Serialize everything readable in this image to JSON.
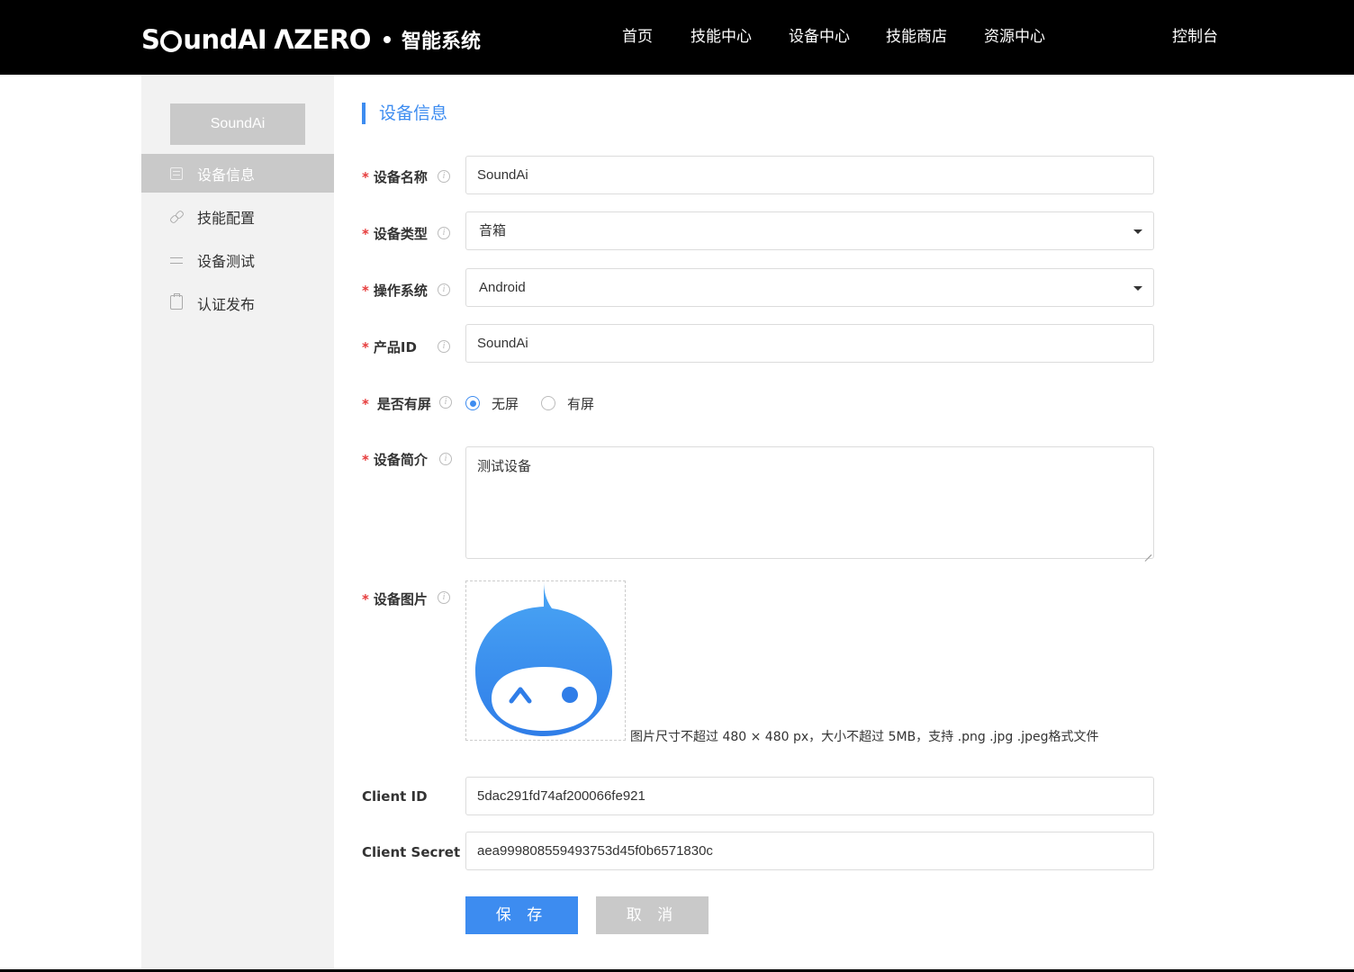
{
  "header": {
    "logo_brand": "S",
    "logo_brand_rest": "undAI",
    "logo_azero": "ΛZERO",
    "logo_subtitle": "智能系统",
    "nav": [
      "首页",
      "技能中心",
      "设备中心",
      "技能商店",
      "资源中心"
    ],
    "console": "控制台"
  },
  "sidebar": {
    "badge": "SoundAi",
    "items": [
      {
        "label": "设备信息",
        "icon": "document-icon",
        "active": true
      },
      {
        "label": "技能配置",
        "icon": "link-icon",
        "active": false
      },
      {
        "label": "设备测试",
        "icon": "sliders-icon",
        "active": false
      },
      {
        "label": "认证发布",
        "icon": "clipboard-icon",
        "active": false
      }
    ]
  },
  "main": {
    "section_title": "设备信息",
    "required_mark": "*",
    "info_glyph": "i",
    "fields": {
      "device_name": {
        "label": "设备名称",
        "value": "SoundAi"
      },
      "device_type": {
        "label": "设备类型",
        "value": "音箱"
      },
      "os": {
        "label": "操作系统",
        "value": "Android"
      },
      "product_id": {
        "label": "产品ID",
        "value": "SoundAi"
      },
      "screen": {
        "label": "是否有屏",
        "options": [
          "无屏",
          "有屏"
        ],
        "selected": "无屏"
      },
      "description": {
        "label": "设备简介",
        "value": "测试设备"
      },
      "image": {
        "label": "设备图片",
        "hint": "图片尺寸不超过 480 × 480 px，大小不超过 5MB，支持 .png .jpg .jpeg格式文件"
      },
      "client_id": {
        "label": "Client ID",
        "value": "5dac291fd74af200066fe921"
      },
      "client_secret": {
        "label": "Client Secret",
        "value": "aea999808559493753d45f0b6571830c"
      }
    },
    "buttons": {
      "save": "保 存",
      "cancel": "取 消"
    }
  },
  "colors": {
    "accent": "#3d8cf0",
    "required": "#e63b3b",
    "sidebar_bg": "#f2f2f2",
    "active_bg": "#c9c9c9"
  }
}
